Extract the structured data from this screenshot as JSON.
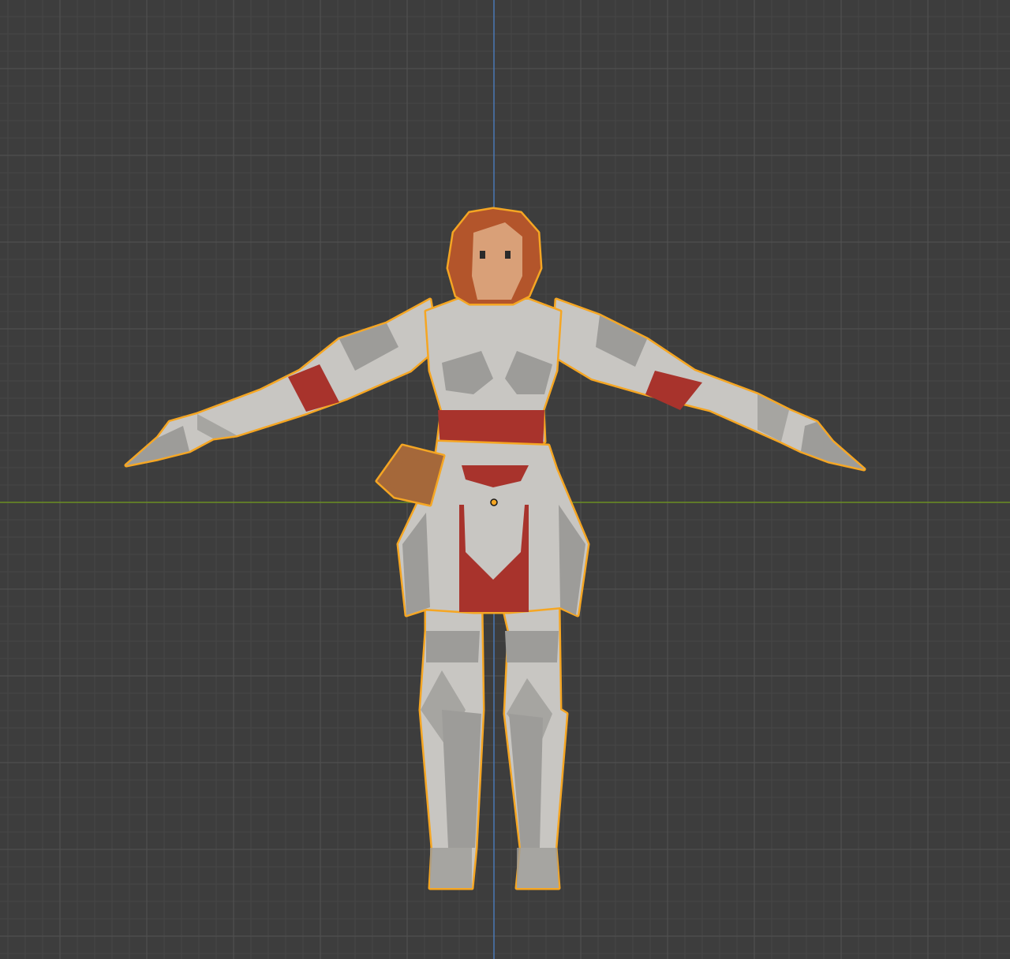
{
  "viewport": {
    "background_color": "#3d3d3d",
    "grid_minor_color": "#474747",
    "grid_major_color": "#525252",
    "x_axis_color": "#6b8e23",
    "z_axis_color": "#4a78b5",
    "selection_outline_color": "#f5a623"
  },
  "model": {
    "selected": true,
    "armor_color": "#c8c6c2",
    "armor_shadow_color": "#9d9c99",
    "cloth_color": "#a8332c",
    "skin_color": "#d9a078",
    "hair_color": "#b3552b",
    "book_color": "#a5683a"
  },
  "origin_point": {
    "icon": "origin-dot-icon"
  }
}
